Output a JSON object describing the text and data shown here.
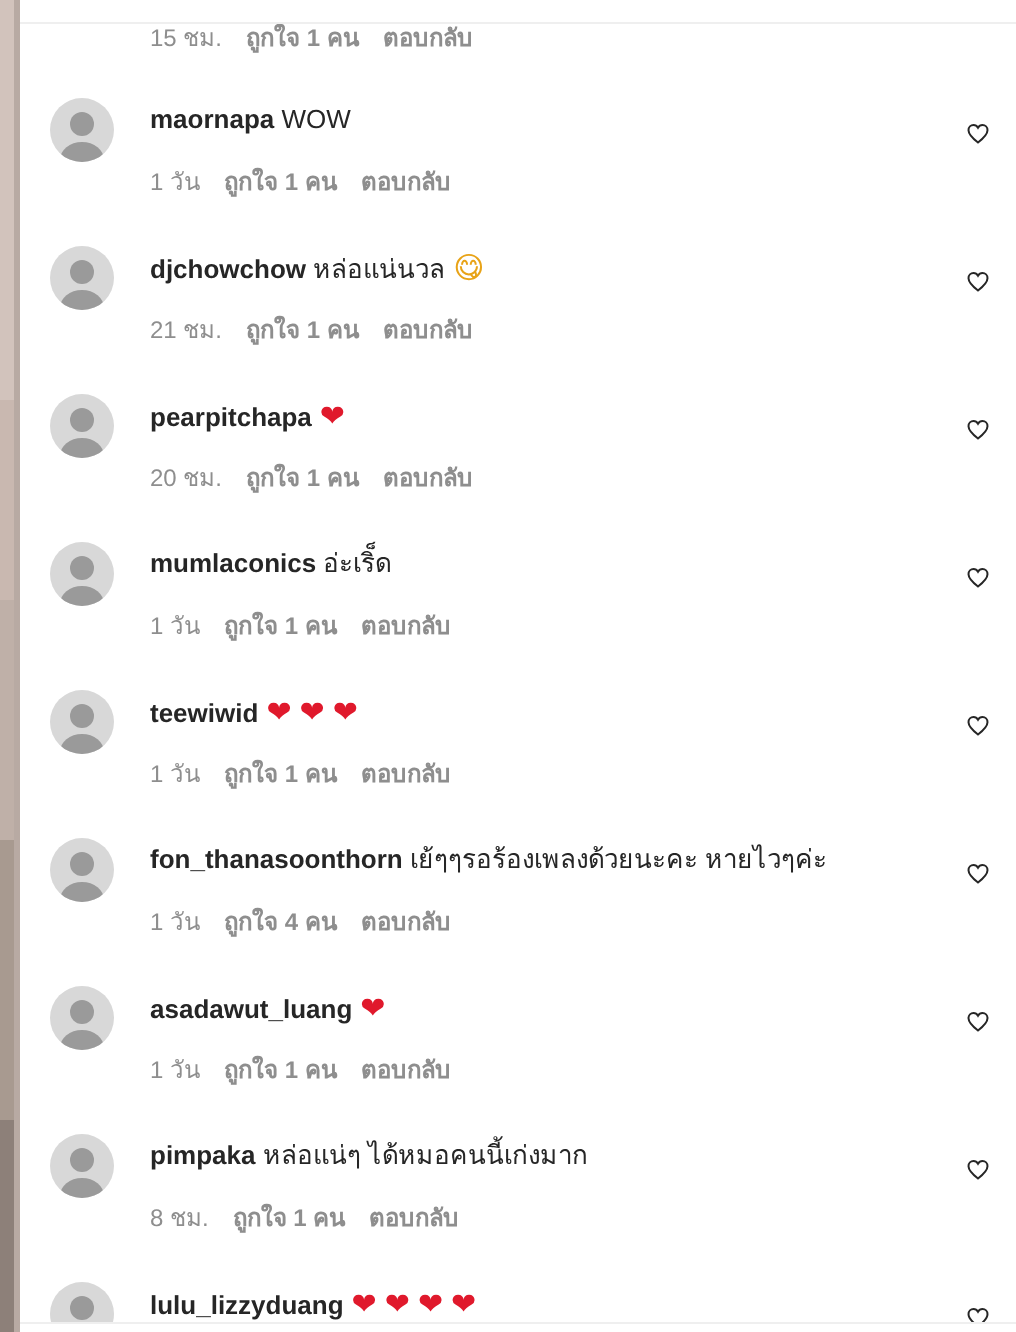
{
  "partial_top": {
    "time": "15 ชม.",
    "likes": "ถูกใจ 1 คน",
    "reply": "ตอบกลับ"
  },
  "comments": [
    {
      "username": "maornapa",
      "text": "WOW",
      "time": "1 วัน",
      "likes": "ถูกใจ 1 คน",
      "reply": "ตอบกลับ",
      "liked": false
    },
    {
      "username": "djchowchow",
      "text": "หล่อแน่นวล",
      "emoji": [
        {
          "char": "😋",
          "kind": "face"
        }
      ],
      "time": "21 ชม.",
      "likes": "ถูกใจ 1 คน",
      "reply": "ตอบกลับ",
      "liked": false
    },
    {
      "username": "pearpitchapa",
      "emoji": [
        {
          "char": "❤",
          "kind": "heart"
        }
      ],
      "time": "20 ชม.",
      "likes": "ถูกใจ 1 คน",
      "reply": "ตอบกลับ",
      "liked": false
    },
    {
      "username": "mumlaconics",
      "text": "อ่ะเริ็ด",
      "time": "1 วัน",
      "likes": "ถูกใจ 1 คน",
      "reply": "ตอบกลับ",
      "liked": false
    },
    {
      "username": "teewiwid",
      "emoji": [
        {
          "char": "❤",
          "kind": "heart"
        },
        {
          "char": "❤",
          "kind": "heart"
        },
        {
          "char": "❤",
          "kind": "heart"
        }
      ],
      "time": "1 วัน",
      "likes": "ถูกใจ 1 คน",
      "reply": "ตอบกลับ",
      "liked": false
    },
    {
      "username": "fon_thanasoonthorn",
      "text": "เย้ๆๆรอร้องเพลงด้วยนะคะ หายไวๆค่ะ",
      "time": "1 วัน",
      "likes": "ถูกใจ 4 คน",
      "reply": "ตอบกลับ",
      "liked": false
    },
    {
      "username": "asadawut_luang",
      "emoji": [
        {
          "char": "❤",
          "kind": "heart"
        }
      ],
      "time": "1 วัน",
      "likes": "ถูกใจ 1 คน",
      "reply": "ตอบกลับ",
      "liked": false
    },
    {
      "username": "pimpaka",
      "text": "หล่อแน่ๆ ได้หมอคนนี้เก่งมาก",
      "time": "8 ชม.",
      "likes": "ถูกใจ 1 คน",
      "reply": "ตอบกลับ",
      "liked": false
    },
    {
      "username": "lulu_lizzyduang",
      "emoji": [
        {
          "char": "❤",
          "kind": "heart"
        },
        {
          "char": "❤",
          "kind": "heart"
        },
        {
          "char": "❤",
          "kind": "heart"
        },
        {
          "char": "❤",
          "kind": "heart"
        }
      ],
      "liked": false
    }
  ]
}
